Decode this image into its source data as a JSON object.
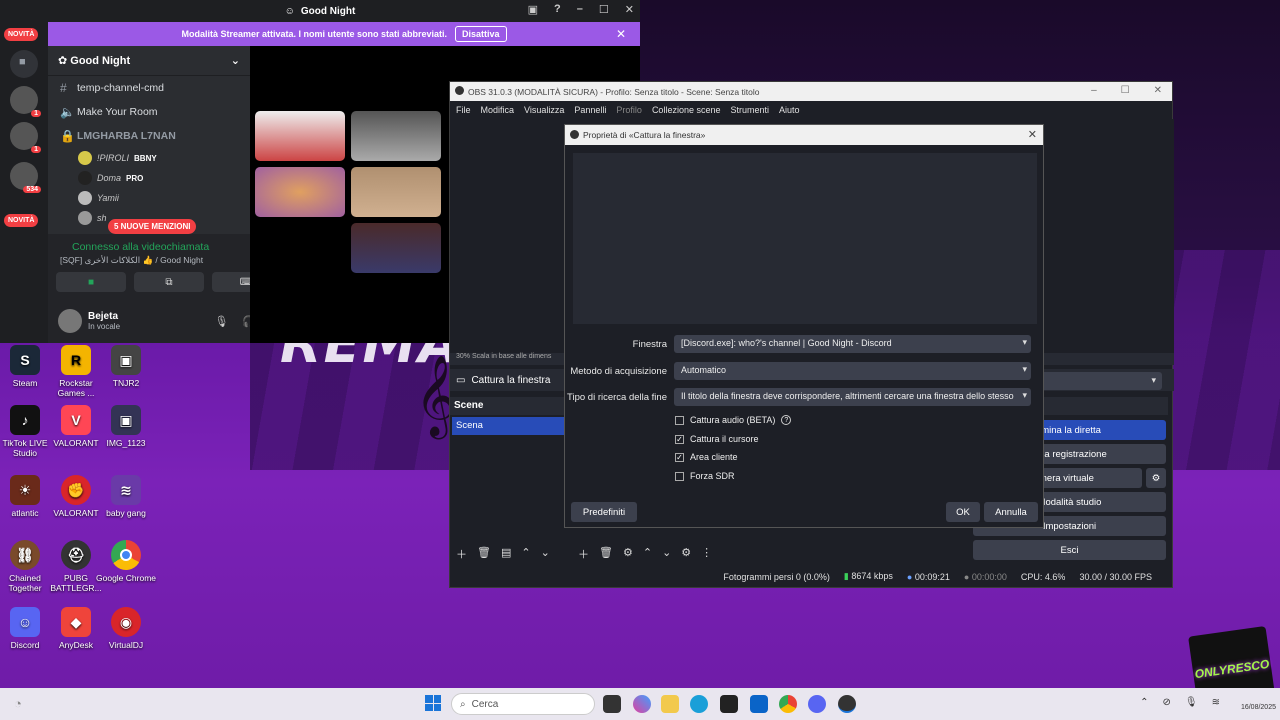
{
  "discord": {
    "window_title": "Good Night",
    "novita_label": "NOVITÀ",
    "streamer_banner": "Modalità Streamer attivata. I nomi utente sono stati abbreviati.",
    "streamer_button": "Disattiva",
    "guild_name": "Good Night",
    "channels": [
      "temp-channel-cmd",
      "Make Your Room"
    ],
    "category": "LMGHARBA L7NAN",
    "voice_users": [
      {
        "name": "!PIROLI",
        "tag": "BBNY"
      },
      {
        "name": "Doma",
        "tag": "PRO"
      },
      {
        "name": "Yamii",
        "tag": ""
      },
      {
        "name": "sh",
        "tag": ""
      }
    ],
    "mentions_badge": "5 NUOVE MENZIONI",
    "voice_connected": "Connesso alla videochiamata",
    "voice_channel": "[SQF] الكلاكات الأخرى 👍 / Good Night",
    "user_name": "Bejeta",
    "user_status": "In vocale",
    "server_badges": [
      "1",
      "1",
      "534"
    ]
  },
  "obs": {
    "window_title": "OBS 31.0.3 (MODALITÀ SICURA) - Profilo: Senza titolo - Scene: Senza titolo",
    "menu": [
      "File",
      "Modifica",
      "Visualizza",
      "Pannelli",
      "Profilo",
      "Collezione scene",
      "Strumenti",
      "Aiuto"
    ],
    "preview_status": "30%   Scala in base alle dimens",
    "source_name": "Cattura la finestra",
    "scenes_header": "Scene",
    "scene_item": "Scena",
    "controls": [
      "rmina la diretta",
      "ia la registrazione",
      "tocamera virtuale",
      "Modalità studio",
      "Impostazioni",
      "Esci"
    ],
    "status": {
      "dropped": "Fotogrammi persi 0 (0.0%)",
      "bitrate": "8674 kbps",
      "live_time": "00:09:21",
      "rec_time": "00:00:00",
      "cpu": "CPU: 4.6%",
      "fps": "30.00 / 30.00 FPS"
    }
  },
  "dialog": {
    "title": "Proprietà di «Cattura la finestra»",
    "fields": [
      {
        "label": "Finestra",
        "value": "[Discord.exe]: who?'s channel | Good Night - Discord"
      },
      {
        "label": "Metodo di acquisizione",
        "value": "Automatico"
      },
      {
        "label": "Tipo di ricerca della fine",
        "value": "Il titolo della finestra deve corrispondere, altrimenti cercare una finestra dello stesso"
      }
    ],
    "checkboxes": [
      {
        "label": "Cattura audio (BETA)",
        "checked": false
      },
      {
        "label": "Cattura il cursore",
        "checked": true
      },
      {
        "label": "Area cliente",
        "checked": true
      },
      {
        "label": "Forza SDR",
        "checked": false
      }
    ],
    "defaults_button": "Predefiniti",
    "ok_button": "OK",
    "cancel_button": "Annulla"
  },
  "desktop": {
    "banner_text": "REMAS",
    "icons": [
      {
        "label": "Steam",
        "color": "#1b2838"
      },
      {
        "label": "Rockstar Games ...",
        "color": "#f4b400"
      },
      {
        "label": "TNJR2",
        "color": "#444"
      },
      {
        "label": "TikTok LIVE Studio",
        "color": "#111"
      },
      {
        "label": "VALORANT",
        "color": "#ff4655"
      },
      {
        "label": "IMG_1123",
        "color": "#335"
      },
      {
        "label": "atlantic",
        "color": "#6a2a1a"
      },
      {
        "label": "VALORANT",
        "color": "#d9252a"
      },
      {
        "label": "baby gang",
        "color": "#6a3aa8"
      },
      {
        "label": "Chained Together",
        "color": "#7a4a2a"
      },
      {
        "label": "PUBG BATTLEGR...",
        "color": "#333"
      },
      {
        "label": "Google Chrome",
        "color": "#4285f4"
      },
      {
        "label": "Discord",
        "color": "#5865f2"
      },
      {
        "label": "AnyDesk",
        "color": "#ef443b"
      },
      {
        "label": "VirtualDJ",
        "color": "#d9252a"
      }
    ],
    "logo_text": "ONLYRESCO"
  },
  "taskbar": {
    "search_placeholder": "Cerca",
    "date": "16/08/2025"
  }
}
